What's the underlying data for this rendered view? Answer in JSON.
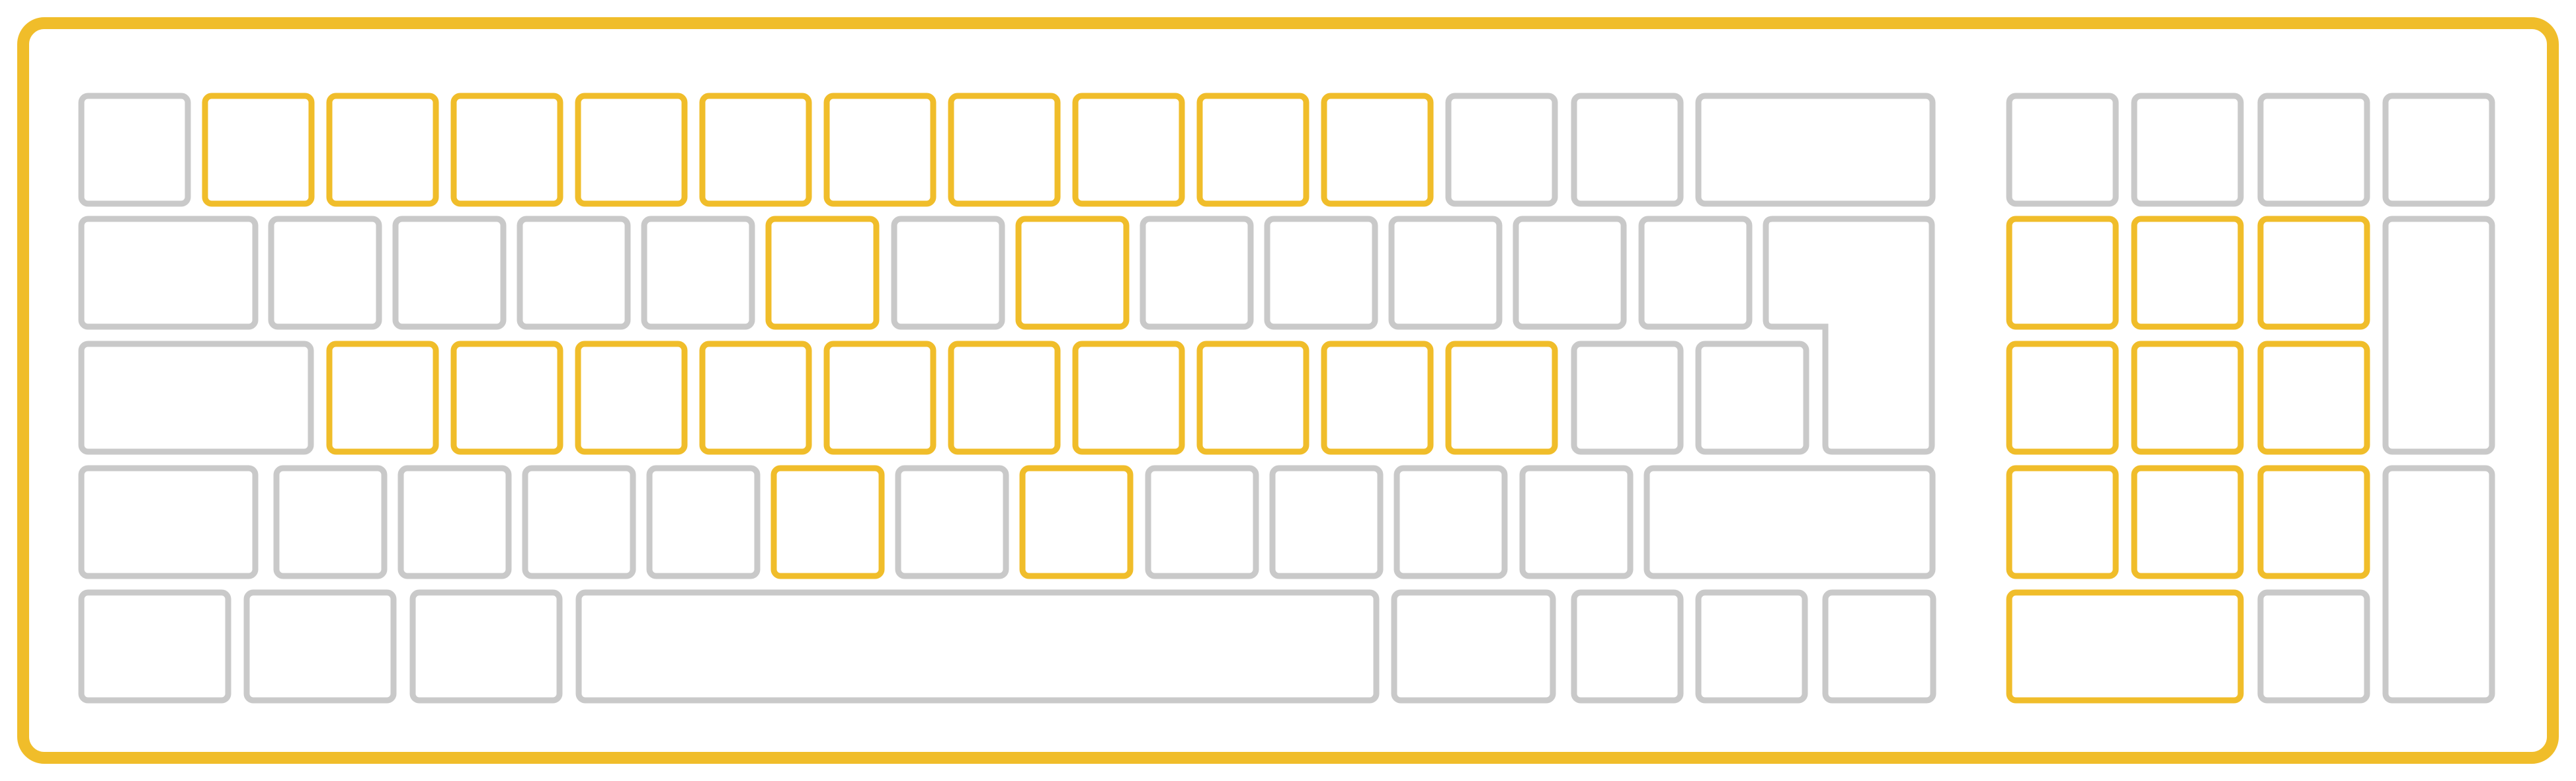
{
  "colors": {
    "background": "#ffffff",
    "frame": "#f0bd2a",
    "highlight": "#f0bd2a",
    "normal": "#c9c9c9"
  },
  "keyboard": {
    "rows": [
      {
        "keys": [
          "normal",
          "highlight",
          "highlight",
          "highlight",
          "highlight",
          "highlight",
          "highlight",
          "highlight",
          "highlight",
          "highlight",
          "highlight",
          "normal",
          "normal",
          "normal"
        ]
      },
      {
        "keys": [
          "normal",
          "normal",
          "normal",
          "normal",
          "normal",
          "highlight",
          "normal",
          "highlight",
          "normal",
          "normal",
          "normal",
          "normal",
          "normal",
          "normal"
        ]
      },
      {
        "keys": [
          "normal",
          "highlight",
          "highlight",
          "highlight",
          "highlight",
          "highlight",
          "highlight",
          "highlight",
          "highlight",
          "highlight",
          "highlight",
          "normal",
          "normal"
        ]
      },
      {
        "keys": [
          "normal",
          "normal",
          "normal",
          "normal",
          "normal",
          "highlight",
          "normal",
          "highlight",
          "normal",
          "normal",
          "normal",
          "normal",
          "normal"
        ]
      },
      {
        "keys": [
          "normal",
          "normal",
          "normal",
          "normal",
          "normal",
          "normal",
          "normal",
          "normal"
        ]
      }
    ],
    "numpad": {
      "keys": [
        "normal",
        "normal",
        "normal",
        "normal",
        "highlight",
        "highlight",
        "highlight",
        "normal",
        "highlight",
        "highlight",
        "highlight",
        "highlight",
        "highlight",
        "highlight",
        "normal",
        "highlight",
        "normal"
      ]
    }
  }
}
